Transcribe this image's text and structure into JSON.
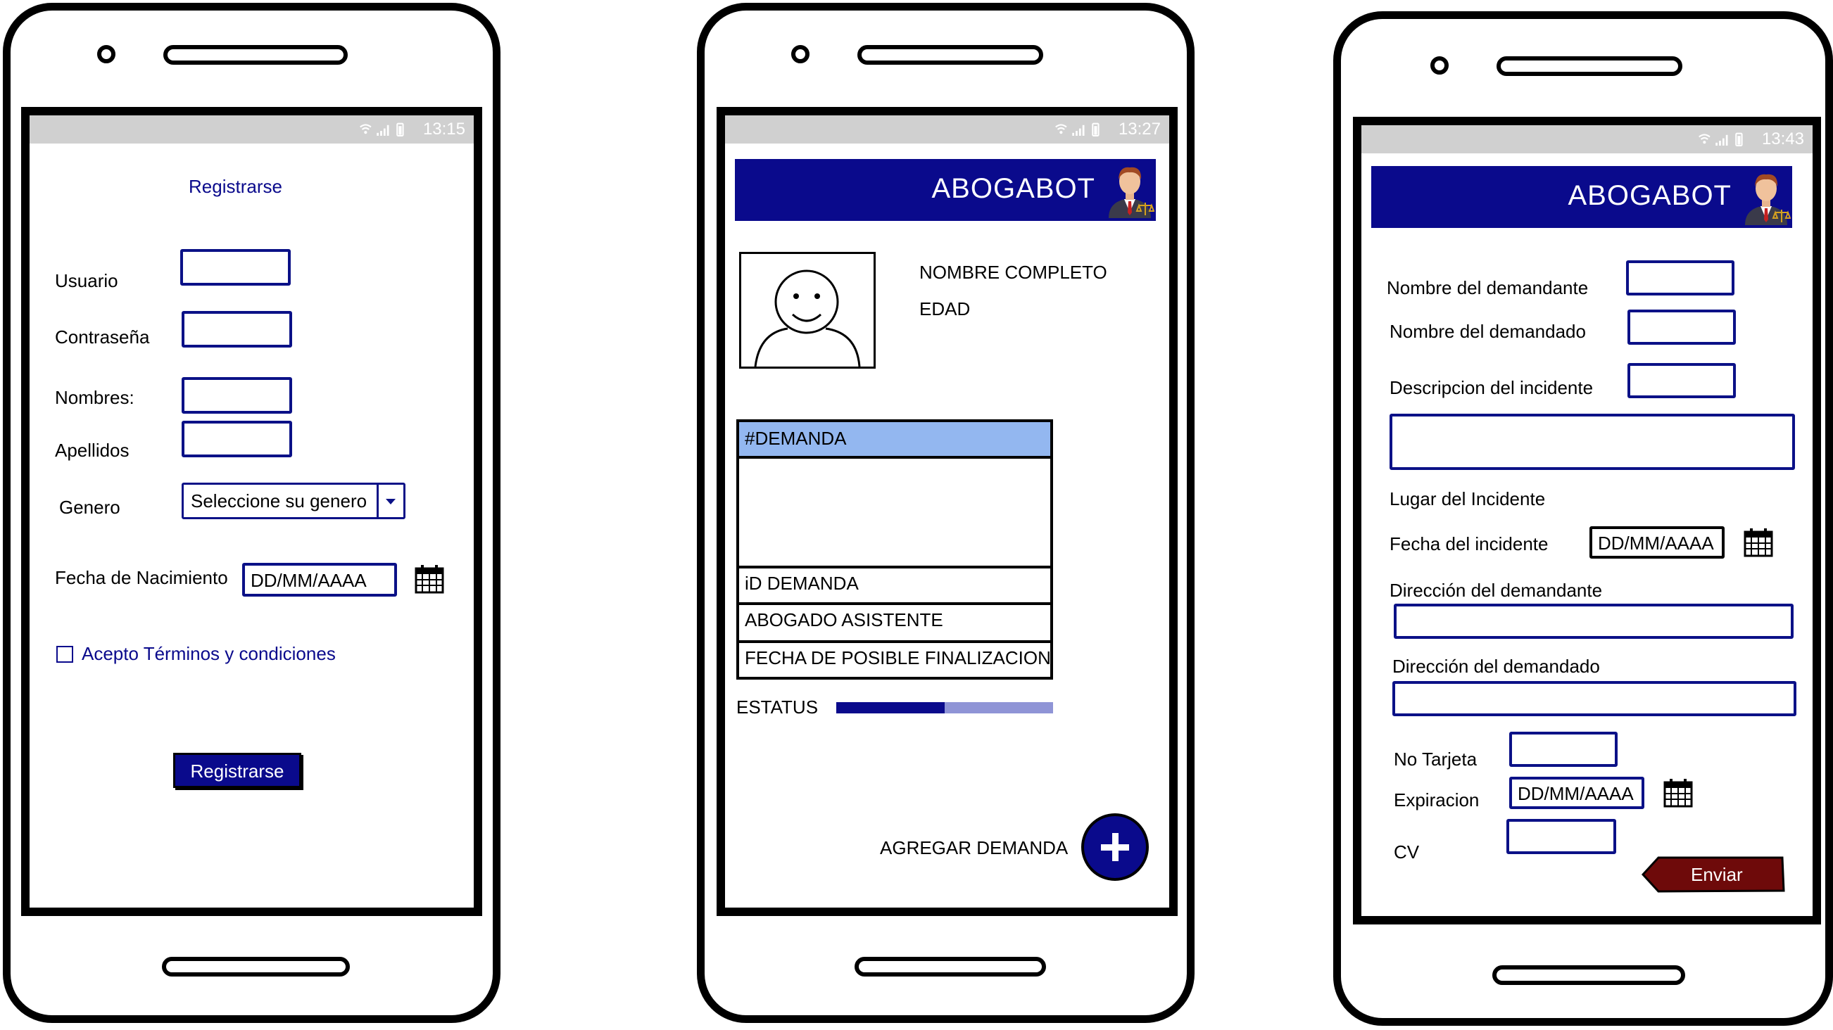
{
  "colors": {
    "primary": "#0a0a8c",
    "field_border": "#0b1187",
    "header_row": "#93b7f0",
    "progress_fill": "#0a0a8c",
    "progress_rest": "#8f94d6",
    "send_button": "#6e0a0a",
    "statusbar": "#d0d0d0"
  },
  "screen1": {
    "status_time": "13:15",
    "title": "Registrarse",
    "usuario_label": "Usuario",
    "contrasena_label": "Contraseña",
    "nombres_label": "Nombres:",
    "apellidos_label": "Apellidos",
    "genero_label": "Genero",
    "genero_select": "Seleccione su genero",
    "fecha_label": "Fecha de Nacimiento",
    "fecha_placeholder": "DD/MM/AAAA",
    "terms_label": "Acepto Términos y condiciones",
    "submit_label": "Registrarse"
  },
  "screen2": {
    "status_time": "13:27",
    "app_title": "ABOGABOT",
    "profile_name": "NOMBRE COMPLETO",
    "profile_age": "EDAD",
    "list_header": "#DEMANDA",
    "rows": [
      "iD DEMANDA",
      "ABOGADO ASISTENTE",
      "FECHA DE POSIBLE FINALIZACION"
    ],
    "status_label": "ESTATUS",
    "status_progress": 0.5,
    "add_label": "AGREGAR DEMANDA"
  },
  "screen3": {
    "status_time": "13:43",
    "app_title": "ABOGABOT",
    "demandante_label": "Nombre del demandante",
    "demandado_label": "Nombre del demandado",
    "descripcion_label": "Descripcion del incidente",
    "lugar_label": "Lugar del Incidente",
    "fecha_label": "Fecha del incidente",
    "fecha_placeholder": "DD/MM/AAAA",
    "dir_demandante_label": "Dirección del demandante",
    "dir_demandado_label": "Dirección del demandado",
    "tarjeta_label": "No Tarjeta",
    "expiracion_label": "Expiracion",
    "expiracion_placeholder": "DD/MM/AAAA",
    "cv_label": "CV",
    "send_label": "Enviar"
  }
}
